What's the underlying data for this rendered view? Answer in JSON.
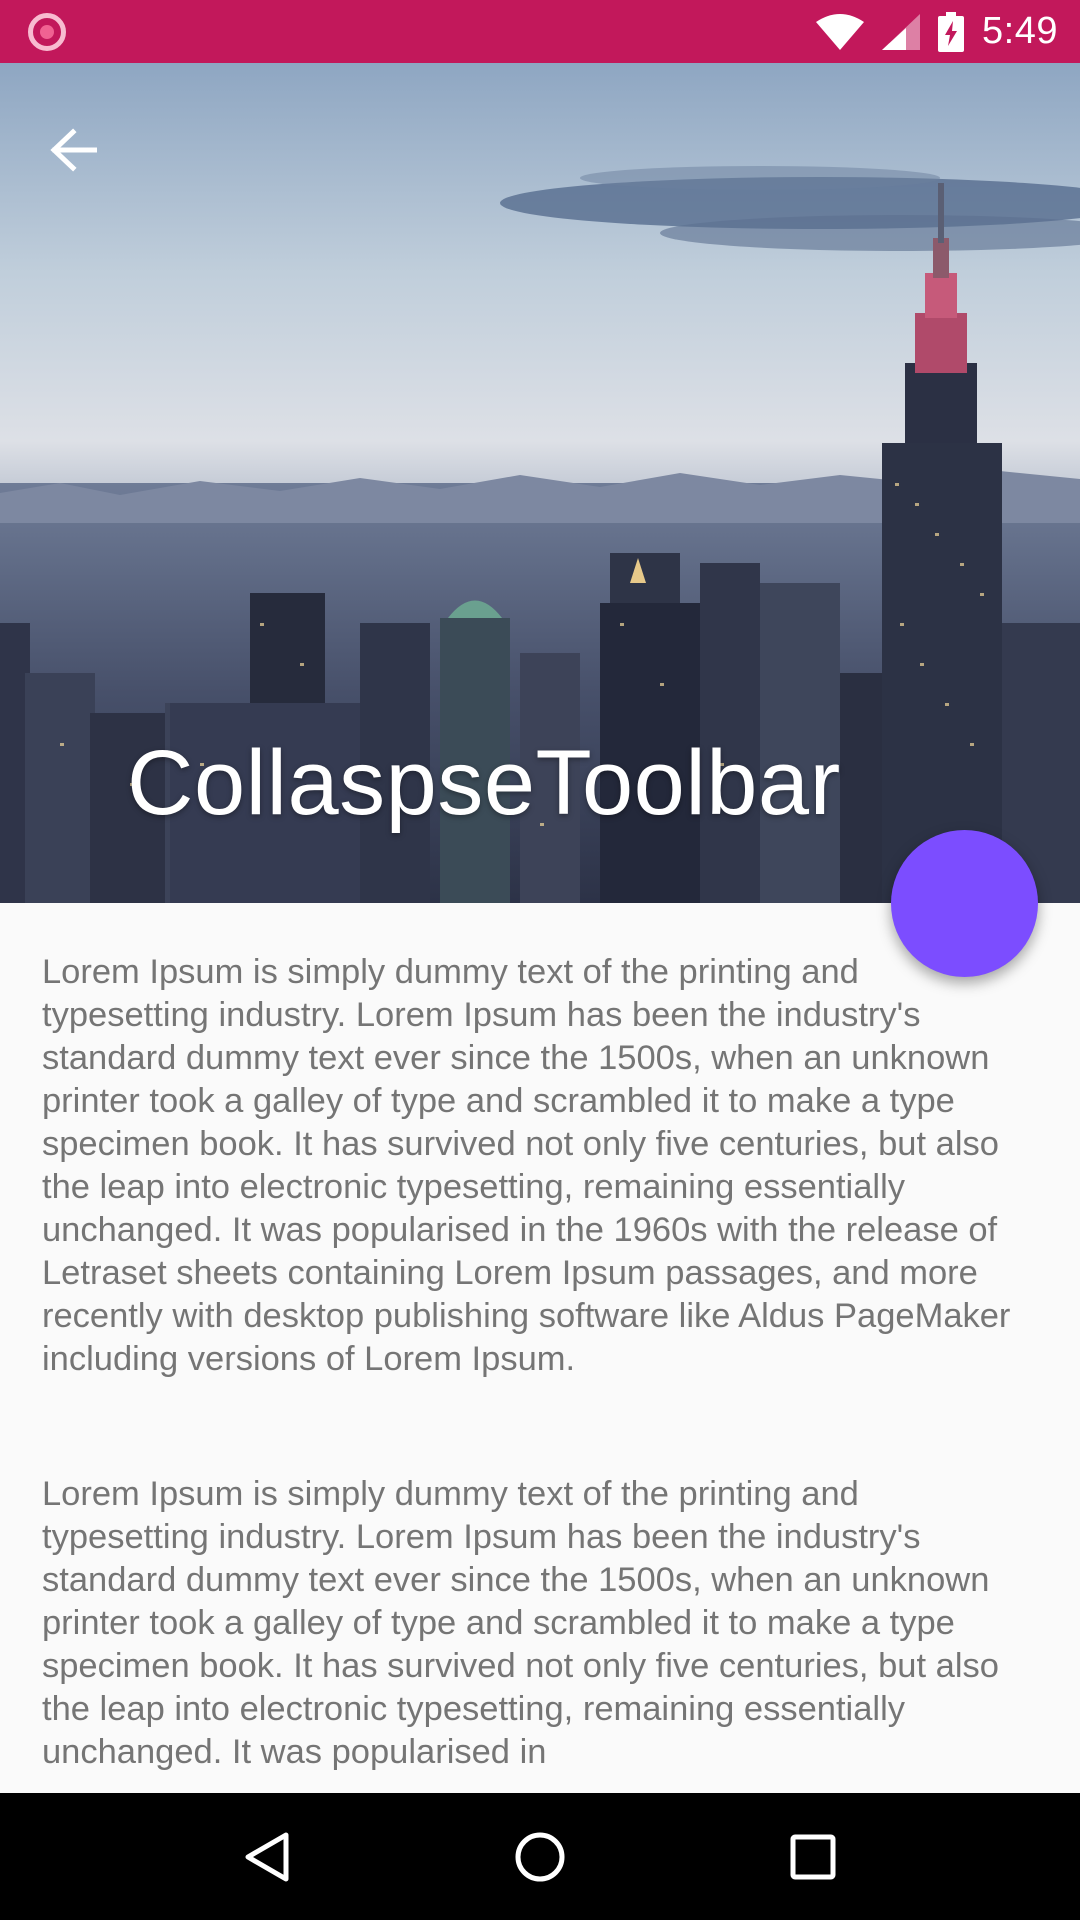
{
  "status_bar": {
    "time": "5:49",
    "icons": [
      "recording-icon",
      "wifi-icon",
      "signal-icon",
      "battery-charging-icon"
    ],
    "background": "#c2185b"
  },
  "toolbar": {
    "title": "CollaspseToolbar",
    "back_icon": "arrow-back-icon",
    "header_image": "city-skyline-image"
  },
  "fab": {
    "color": "#7c4dff"
  },
  "content": {
    "paragraphs": [
      "Lorem Ipsum is simply dummy text of the printing and typesetting industry. Lorem Ipsum has been the industry's standard dummy text ever since the 1500s, when an unknown printer took a galley of type and scrambled it to make a type specimen book. It has survived not only five centuries, but also the leap into electronic typesetting, remaining essentially unchanged. It was popularised in the 1960s with the release of Letraset sheets containing Lorem Ipsum passages, and more recently with desktop publishing software like Aldus PageMaker including versions of Lorem Ipsum.",
      "Lorem Ipsum is simply dummy text of the printing and typesetting industry. Lorem Ipsum has been the industry's standard dummy text ever since the 1500s, when an unknown printer took a galley of type and scrambled it to make a type specimen book. It has survived not only five centuries, but also the leap into electronic typesetting, remaining essentially unchanged. It was popularised in"
    ]
  },
  "nav_bar": {
    "buttons": [
      "back-triangle-icon",
      "home-circle-icon",
      "recents-square-icon"
    ]
  }
}
